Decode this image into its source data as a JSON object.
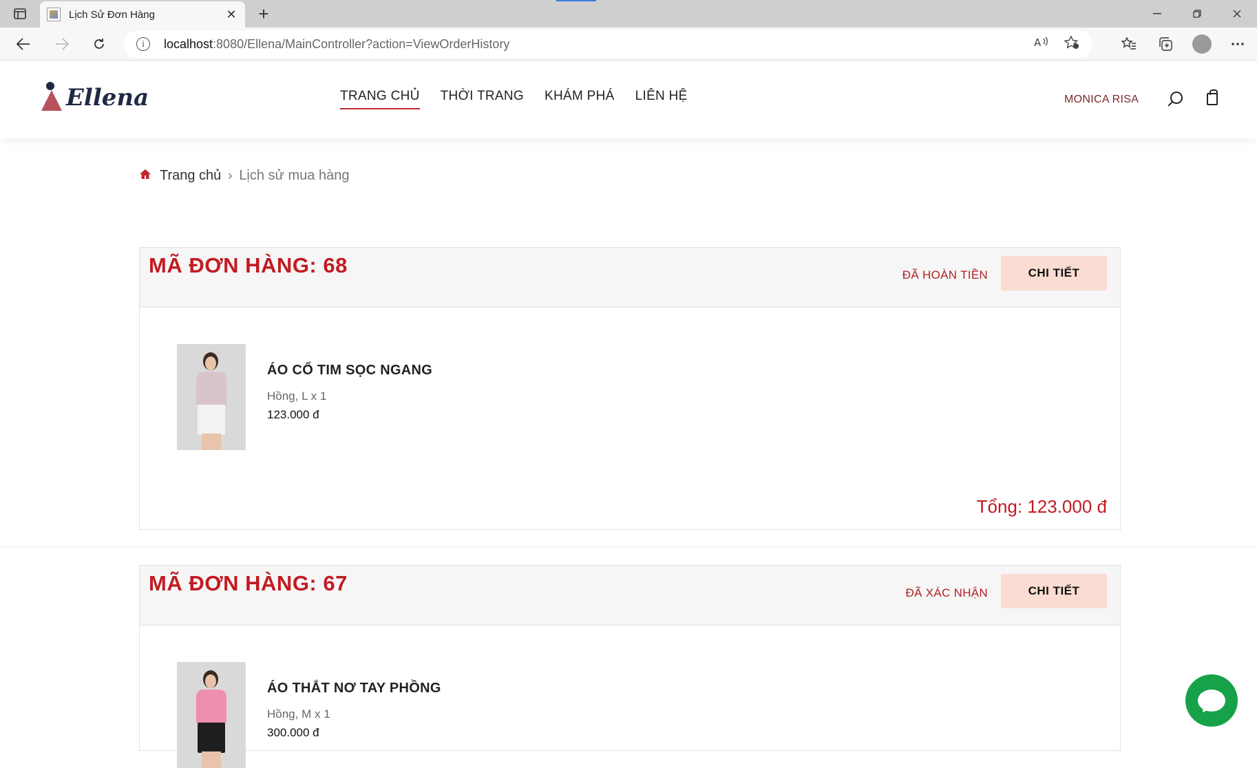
{
  "browser": {
    "tab_title": "Lịch Sử Đơn Hàng",
    "url_host": "localhost",
    "url_path": ":8080/Ellena/MainController?action=ViewOrderHistory",
    "new_tab": "+",
    "close_tab": "✕"
  },
  "site": {
    "logo_text": "Ellena",
    "nav": [
      {
        "label": "TRANG CHỦ"
      },
      {
        "label": "THỜI TRANG"
      },
      {
        "label": "KHÁM PHÁ"
      },
      {
        "label": "LIÊN HỆ"
      }
    ],
    "user_name": "MONICA RISA"
  },
  "breadcrumb": {
    "home": "Trang chủ",
    "separator": "›",
    "current": "Lịch sử mua hàng"
  },
  "orders": [
    {
      "id_label": "MÃ ĐƠN HÀNG: 68",
      "status": "ĐÃ HOÀN TIỀN",
      "detail_label": "CHI TIẾT",
      "item": {
        "name": "ÁO CỔ TIM SỌC NGANG",
        "variant": "Hồng, L x 1",
        "price": "123.000 đ",
        "top_color": "#d9c4cc",
        "bottom_color": "#f2f2f2"
      },
      "total": "Tổng: 123.000 đ"
    },
    {
      "id_label": "MÃ ĐƠN HÀNG: 67",
      "status": "ĐÃ XÁC NHẬN",
      "detail_label": "CHI TIẾT",
      "item": {
        "name": "ÁO THẮT NƠ TAY PHỒNG",
        "variant": "Hồng, M x 1",
        "price": "300.000 đ",
        "top_color": "#ef8fb0",
        "bottom_color": "#1e1e1e"
      }
    }
  ],
  "colors": {
    "accent_red": "#c21b22",
    "button_bg": "#fbdcd2",
    "chat_green": "#17a24a"
  }
}
